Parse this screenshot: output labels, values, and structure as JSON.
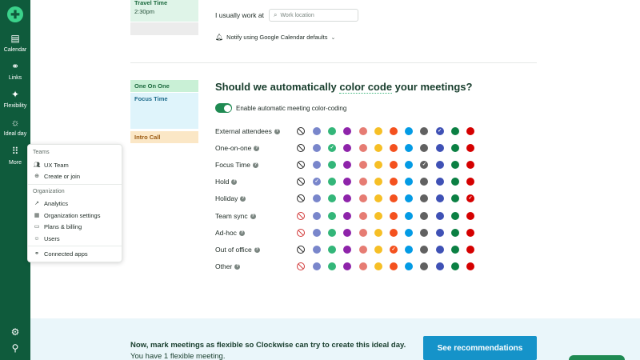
{
  "rail": {
    "nav": [
      {
        "label": "Calendar",
        "icon": "calendar-icon"
      },
      {
        "label": "Links",
        "icon": "link-icon"
      },
      {
        "label": "Flexibility",
        "icon": "sparkle-icon"
      },
      {
        "label": "Ideal day",
        "icon": "sun-icon"
      },
      {
        "label": "More",
        "icon": "grid-icon"
      }
    ],
    "bottom_icons": [
      "gear-icon",
      "add-user-icon"
    ]
  },
  "menu": {
    "teams_header": "Teams",
    "teams_items": [
      {
        "label": "UX Team",
        "icon": "people-icon"
      },
      {
        "label": "Create or join",
        "icon": "plus-circle-icon"
      }
    ],
    "org_header": "Organization",
    "org_items": [
      {
        "label": "Analytics",
        "icon": "trend-icon"
      },
      {
        "label": "Organization settings",
        "icon": "building-icon"
      },
      {
        "label": "Plans & billing",
        "icon": "card-icon"
      },
      {
        "label": "Users",
        "icon": "user-icon"
      }
    ],
    "extra_items": [
      {
        "label": "Connected apps",
        "icon": "link-icon"
      }
    ]
  },
  "schedule": {
    "travel_title": "Travel Time",
    "travel_time": "2:30pm",
    "one_on_one": "One On One",
    "focus_time": "Focus Time",
    "intro_call": "Intro Call"
  },
  "work": {
    "label": "I usually work at",
    "placeholder": "Work location",
    "notify": "Notify using Google Calendar defaults"
  },
  "colorcode": {
    "heading_pre": "Should we automatically ",
    "heading_em": "color code",
    "heading_post": " your meetings?",
    "toggle_label": "Enable automatic meeting color-coding",
    "toggle_on": true
  },
  "palette": [
    "#7986cb",
    "#33b679",
    "#8e24aa",
    "#e67c73",
    "#f6bf26",
    "#f4511e",
    "#039be5",
    "#616161",
    "#3f51b5",
    "#0b8043",
    "#d50000"
  ],
  "rows": [
    {
      "label": "External attendees",
      "help": true,
      "none_style": "dark",
      "selected": 8
    },
    {
      "label": "One-on-one",
      "help": true,
      "none_style": "dark",
      "selected": 1
    },
    {
      "label": "Focus Time",
      "help": true,
      "none_style": "dark",
      "selected": 7
    },
    {
      "label": "Hold",
      "help": true,
      "none_style": "dark",
      "selected": 0
    },
    {
      "label": "Holiday",
      "help": true,
      "none_style": "dark",
      "selected": 10
    },
    {
      "label": "Team sync",
      "help": true,
      "none_style": "red",
      "selected": null
    },
    {
      "label": "Ad-hoc",
      "help": true,
      "none_style": "red",
      "selected": null
    },
    {
      "label": "Out of office",
      "help": true,
      "none_style": "dark",
      "selected": 5
    },
    {
      "label": "Other",
      "help": true,
      "none_style": "red",
      "selected": null
    }
  ],
  "banner": {
    "bold": "Now, mark meetings as flexible so Clockwise can try to create this ideal day.",
    "rest": " You have 1 flexible meeting.",
    "button": "See recommendations"
  }
}
